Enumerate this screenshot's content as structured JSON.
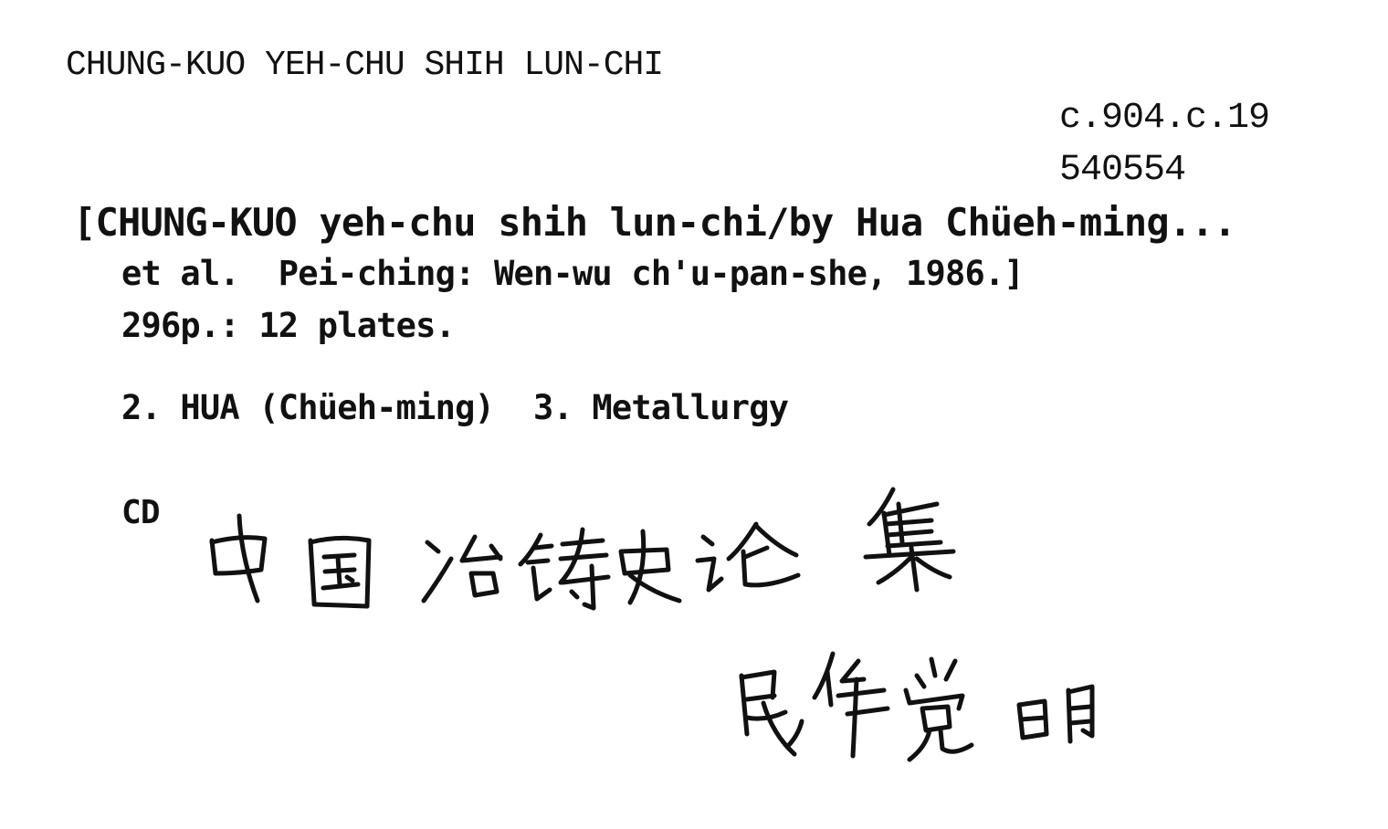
{
  "card": {
    "heading": "CHUNG-KUO YEH-CHU SHIH LUN-CHI",
    "shelfmark": "c.904.c.19",
    "accession": "540554",
    "lines": [
      "[CHUNG-KUO yeh-chu shih lun-chi/by Hua Chüeh-ming...",
      "et al.  Pei-ching: Wen-wu ch'u-pan-she, 1986.]",
      "296p.: 12 plates.",
      "2. HUA (Chüeh-ming)  3. Metallurgy",
      "CD"
    ],
    "handwritten_title": "中国冶铸史论集",
    "handwritten_author": "华觉明"
  }
}
